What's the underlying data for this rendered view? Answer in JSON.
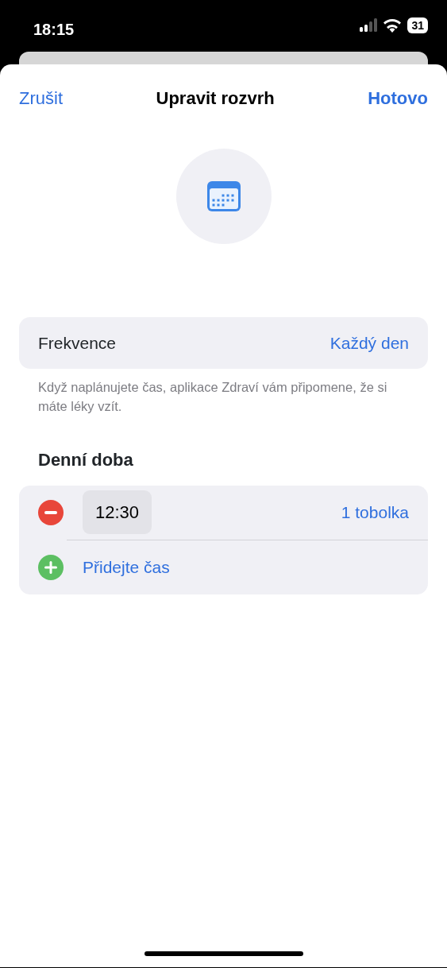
{
  "status_bar": {
    "time": "18:15",
    "battery": "31"
  },
  "nav": {
    "cancel": "Zrušit",
    "title": "Upravit rozvrh",
    "done": "Hotovo"
  },
  "frequency": {
    "label": "Frekvence",
    "value": "Každý den",
    "footnote": "Když naplánujete čas, aplikace Zdraví vám připomene, že si máte léky vzít."
  },
  "section_title": "Denní doba",
  "times": [
    {
      "time": "12:30",
      "dose": "1 tobolka"
    }
  ],
  "add_time": "Přidejte čas"
}
